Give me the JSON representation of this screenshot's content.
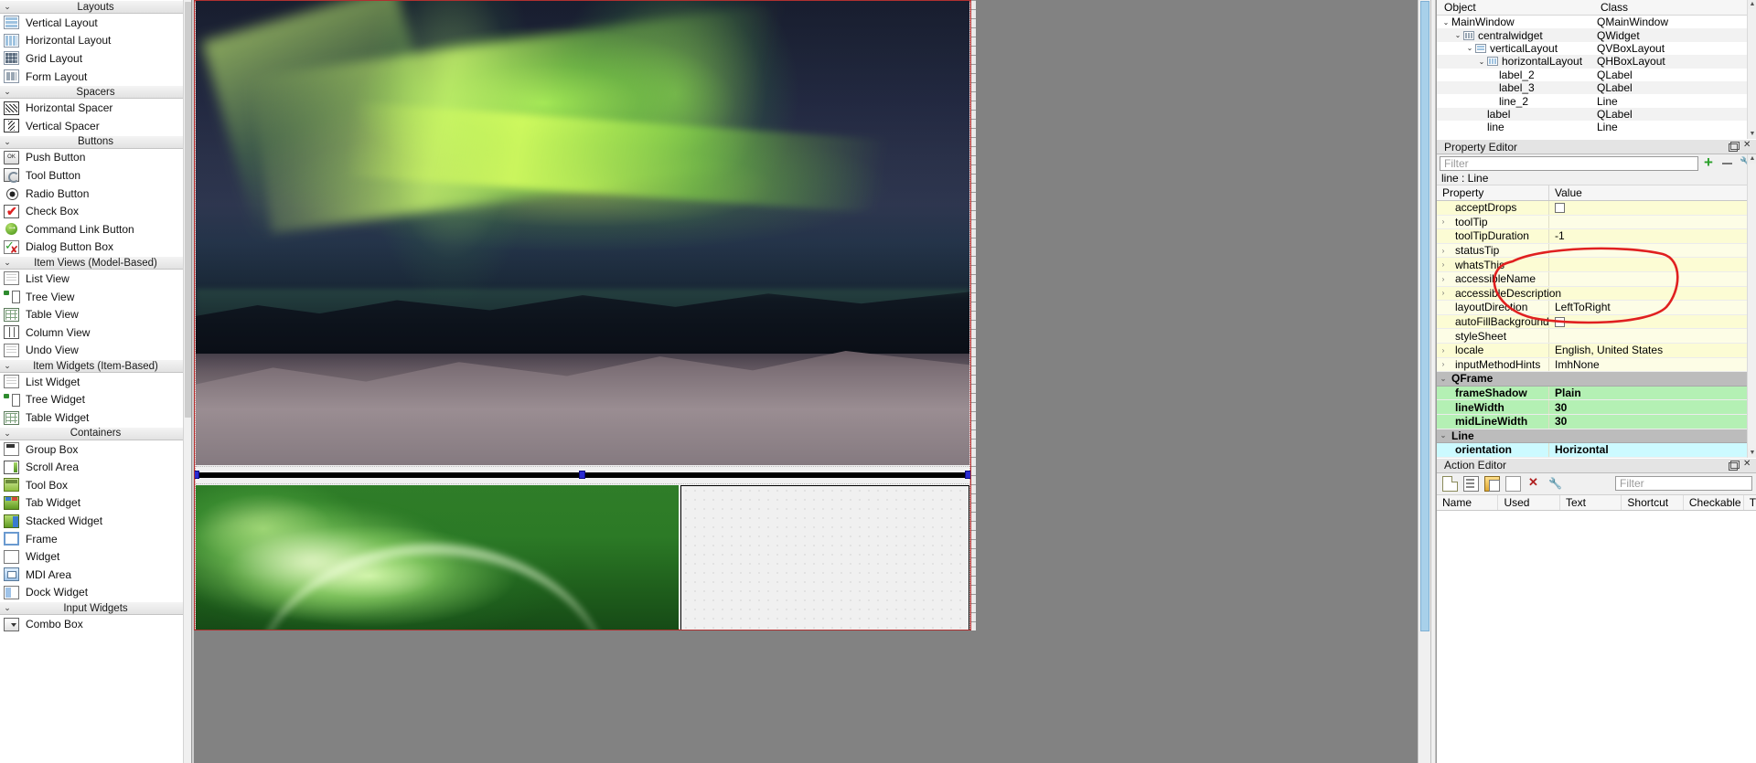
{
  "widget_box": {
    "scroll": "widget-box-scrollbar",
    "categories": [
      {
        "name": "Layouts",
        "items": [
          {
            "label": "Vertical Layout",
            "icon": "vertical-layout-icon",
            "css": "ic-vlayout"
          },
          {
            "label": "Horizontal Layout",
            "icon": "horizontal-layout-icon",
            "css": "ic-hlayout"
          },
          {
            "label": "Grid Layout",
            "icon": "grid-layout-icon",
            "css": "ic-grid"
          },
          {
            "label": "Form Layout",
            "icon": "form-layout-icon",
            "css": "ic-form"
          }
        ]
      },
      {
        "name": "Spacers",
        "items": [
          {
            "label": "Horizontal Spacer",
            "icon": "horizontal-spacer-icon",
            "css": "ic-hspacer"
          },
          {
            "label": "Vertical Spacer",
            "icon": "vertical-spacer-icon",
            "css": "ic-vspacer"
          }
        ]
      },
      {
        "name": "Buttons",
        "items": [
          {
            "label": "Push Button",
            "icon": "push-button-icon",
            "css": "ic-push"
          },
          {
            "label": "Tool Button",
            "icon": "tool-button-icon",
            "css": "ic-tool"
          },
          {
            "label": "Radio Button",
            "icon": "radio-button-icon",
            "css": "ic-radio"
          },
          {
            "label": "Check Box",
            "icon": "check-box-icon",
            "css": "ic-check"
          },
          {
            "label": "Command Link Button",
            "icon": "command-link-button-icon",
            "css": "ic-cmdlink"
          },
          {
            "label": "Dialog Button Box",
            "icon": "dialog-button-box-icon",
            "css": "ic-dlgbtn"
          }
        ]
      },
      {
        "name": "Item Views (Model-Based)",
        "items": [
          {
            "label": "List View",
            "icon": "list-view-icon",
            "css": "ic-listview"
          },
          {
            "label": "Tree View",
            "icon": "tree-view-icon",
            "css": "ic-treeview"
          },
          {
            "label": "Table View",
            "icon": "table-view-icon",
            "css": "ic-tableview"
          },
          {
            "label": "Column View",
            "icon": "column-view-icon",
            "css": "ic-colview"
          },
          {
            "label": "Undo View",
            "icon": "undo-view-icon",
            "css": "ic-listview"
          }
        ]
      },
      {
        "name": "Item Widgets (Item-Based)",
        "items": [
          {
            "label": "List Widget",
            "icon": "list-widget-icon",
            "css": "ic-listview"
          },
          {
            "label": "Tree Widget",
            "icon": "tree-widget-icon",
            "css": "ic-treeview"
          },
          {
            "label": "Table Widget",
            "icon": "table-widget-icon",
            "css": "ic-tableview"
          }
        ]
      },
      {
        "name": "Containers",
        "items": [
          {
            "label": "Group Box",
            "icon": "group-box-icon",
            "css": "ic-groupbox"
          },
          {
            "label": "Scroll Area",
            "icon": "scroll-area-icon",
            "css": "ic-scrollarea"
          },
          {
            "label": "Tool Box",
            "icon": "tool-box-icon",
            "css": "ic-toolbox"
          },
          {
            "label": "Tab Widget",
            "icon": "tab-widget-icon",
            "css": "ic-tabwidget"
          },
          {
            "label": "Stacked Widget",
            "icon": "stacked-widget-icon",
            "css": "ic-stacked"
          },
          {
            "label": "Frame",
            "icon": "frame-icon",
            "css": "ic-frame"
          },
          {
            "label": "Widget",
            "icon": "widget-icon",
            "css": "ic-widget"
          },
          {
            "label": "MDI Area",
            "icon": "mdi-area-icon",
            "css": "ic-mdi"
          },
          {
            "label": "Dock Widget",
            "icon": "dock-widget-icon",
            "css": "ic-dock"
          }
        ]
      },
      {
        "name": "Input Widgets",
        "items": [
          {
            "label": "Combo Box",
            "icon": "combo-box-icon",
            "css": "ic-combo"
          }
        ]
      }
    ]
  },
  "object_inspector": {
    "columns": [
      "Object",
      "Class"
    ],
    "rows": [
      {
        "name": "MainWindow",
        "cls": "QMainWindow",
        "indent": 0,
        "chev": "⌄",
        "icon": ""
      },
      {
        "name": "centralwidget",
        "cls": "QWidget",
        "indent": 1,
        "chev": "⌄",
        "icon": "twi-grid"
      },
      {
        "name": "verticalLayout",
        "cls": "QVBoxLayout",
        "indent": 2,
        "chev": "⌄",
        "icon": "twi-vl"
      },
      {
        "name": "horizontalLayout",
        "cls": "QHBoxLayout",
        "indent": 3,
        "chev": "⌄",
        "icon": "twi-hl"
      },
      {
        "name": "label_2",
        "cls": "QLabel",
        "indent": 4,
        "chev": "",
        "icon": ""
      },
      {
        "name": "label_3",
        "cls": "QLabel",
        "indent": 4,
        "chev": "",
        "icon": ""
      },
      {
        "name": "line_2",
        "cls": "Line",
        "indent": 4,
        "chev": "",
        "icon": ""
      },
      {
        "name": "label",
        "cls": "QLabel",
        "indent": 3,
        "chev": "",
        "icon": ""
      },
      {
        "name": "line",
        "cls": "Line",
        "indent": 3,
        "chev": "",
        "icon": ""
      }
    ]
  },
  "property_editor": {
    "title": "Property Editor",
    "filter_placeholder": "Filter",
    "object_line": "line : Line",
    "columns": [
      "Property",
      "Value"
    ],
    "rows": [
      {
        "name": "acceptDrops",
        "value": "",
        "expand": false,
        "kind": "y0",
        "checkbox": true
      },
      {
        "name": "toolTip",
        "value": "",
        "expand": true,
        "kind": "y1",
        "checkbox": false
      },
      {
        "name": "toolTipDuration",
        "value": "-1",
        "expand": false,
        "kind": "y0",
        "checkbox": false
      },
      {
        "name": "statusTip",
        "value": "",
        "expand": true,
        "kind": "y1",
        "checkbox": false
      },
      {
        "name": "whatsThis",
        "value": "",
        "expand": true,
        "kind": "y0",
        "checkbox": false
      },
      {
        "name": "accessibleName",
        "value": "",
        "expand": true,
        "kind": "y1",
        "checkbox": false
      },
      {
        "name": "accessibleDescription",
        "value": "",
        "expand": true,
        "kind": "y0",
        "checkbox": false
      },
      {
        "name": "layoutDirection",
        "value": "LeftToRight",
        "expand": false,
        "kind": "y1",
        "checkbox": false
      },
      {
        "name": "autoFillBackground",
        "value": "",
        "expand": false,
        "kind": "y0",
        "checkbox": true
      },
      {
        "name": "styleSheet",
        "value": "",
        "expand": false,
        "kind": "y1",
        "checkbox": false
      },
      {
        "name": "locale",
        "value": "English, United States",
        "expand": true,
        "kind": "y0",
        "checkbox": false
      },
      {
        "name": "inputMethodHints",
        "value": "ImhNone",
        "expand": true,
        "kind": "y1",
        "checkbox": false
      },
      {
        "name": "QFrame",
        "value": "",
        "expand": true,
        "kind": "group",
        "checkbox": false
      },
      {
        "name": "frameShadow",
        "value": "Plain",
        "expand": false,
        "kind": "green",
        "checkbox": false
      },
      {
        "name": "lineWidth",
        "value": "30",
        "expand": false,
        "kind": "green",
        "checkbox": false
      },
      {
        "name": "midLineWidth",
        "value": "30",
        "expand": false,
        "kind": "green",
        "checkbox": false
      },
      {
        "name": "Line",
        "value": "",
        "expand": true,
        "kind": "group",
        "checkbox": false
      },
      {
        "name": "orientation",
        "value": "Horizontal",
        "expand": false,
        "kind": "cyan",
        "checkbox": false
      }
    ]
  },
  "action_editor": {
    "title": "Action Editor",
    "filter_placeholder": "Filter",
    "toolbar": [
      {
        "label": "New",
        "icon": "new-action-icon",
        "css": "newa"
      },
      {
        "label": "Edit",
        "icon": "edit-action-icon",
        "css": "edita"
      },
      {
        "label": "Copy",
        "icon": "copy-action-icon",
        "css": "copya"
      },
      {
        "label": "Paste",
        "icon": "paste-action-icon",
        "css": "pastea"
      },
      {
        "label": "Delete",
        "icon": "delete-action-icon",
        "css": "delx"
      },
      {
        "label": "Configure",
        "icon": "configure-icon",
        "css": "cfg2"
      }
    ],
    "columns": [
      "Name",
      "Used",
      "Text",
      "Shortcut",
      "Checkable",
      "T"
    ],
    "rows": []
  },
  "form_canvas": {
    "widgets": [
      {
        "name": "label_2",
        "type": "QLabel",
        "content": "aurora-photo"
      },
      {
        "name": "line",
        "type": "Line",
        "content": "horizontal-line-selected"
      },
      {
        "name": "label",
        "type": "QLabel",
        "content": "green-aurora-photo"
      },
      {
        "name": "line_2",
        "type": "Line",
        "content": "empty-dotted-panel"
      }
    ]
  },
  "colors": {
    "selection_handle": "#2a2ad0",
    "annotation_red": "#e02020",
    "highlight_green": "#b4f0b4",
    "highlight_cyan": "#ccfaff",
    "property_yellow": "#fcfcd4",
    "form_border": "#b03030"
  }
}
